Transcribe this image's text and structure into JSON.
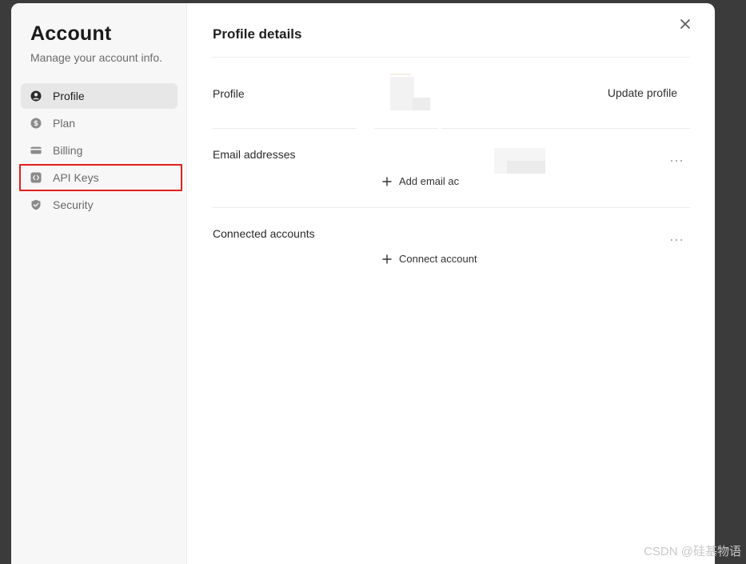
{
  "sidebar": {
    "title": "Account",
    "subtitle": "Manage your account info.",
    "items": [
      {
        "label": "Profile",
        "icon": "user-circle-icon",
        "active": true
      },
      {
        "label": "Plan",
        "icon": "dollar-circle-icon",
        "active": false
      },
      {
        "label": "Billing",
        "icon": "credit-card-icon",
        "active": false
      },
      {
        "label": "API Keys",
        "icon": "code-square-icon",
        "active": false,
        "highlighted": true
      },
      {
        "label": "Security",
        "icon": "shield-check-icon",
        "active": false
      }
    ]
  },
  "main": {
    "title": "Profile details",
    "close_icon": "close-icon",
    "profile": {
      "label": "Profile",
      "action": "Update profile"
    },
    "email": {
      "label": "Email addresses",
      "add_label": "Add email ac",
      "menu_icon": "more-horizontal-icon"
    },
    "connected": {
      "label": "Connected accounts",
      "add_label": "Connect account",
      "menu_icon": "more-horizontal-icon"
    }
  },
  "watermark": "CSDN @硅基物语",
  "colors": {
    "highlight": "#e2201c",
    "sidebar_bg": "#f7f7f7",
    "backdrop": "#3b3b3b"
  }
}
